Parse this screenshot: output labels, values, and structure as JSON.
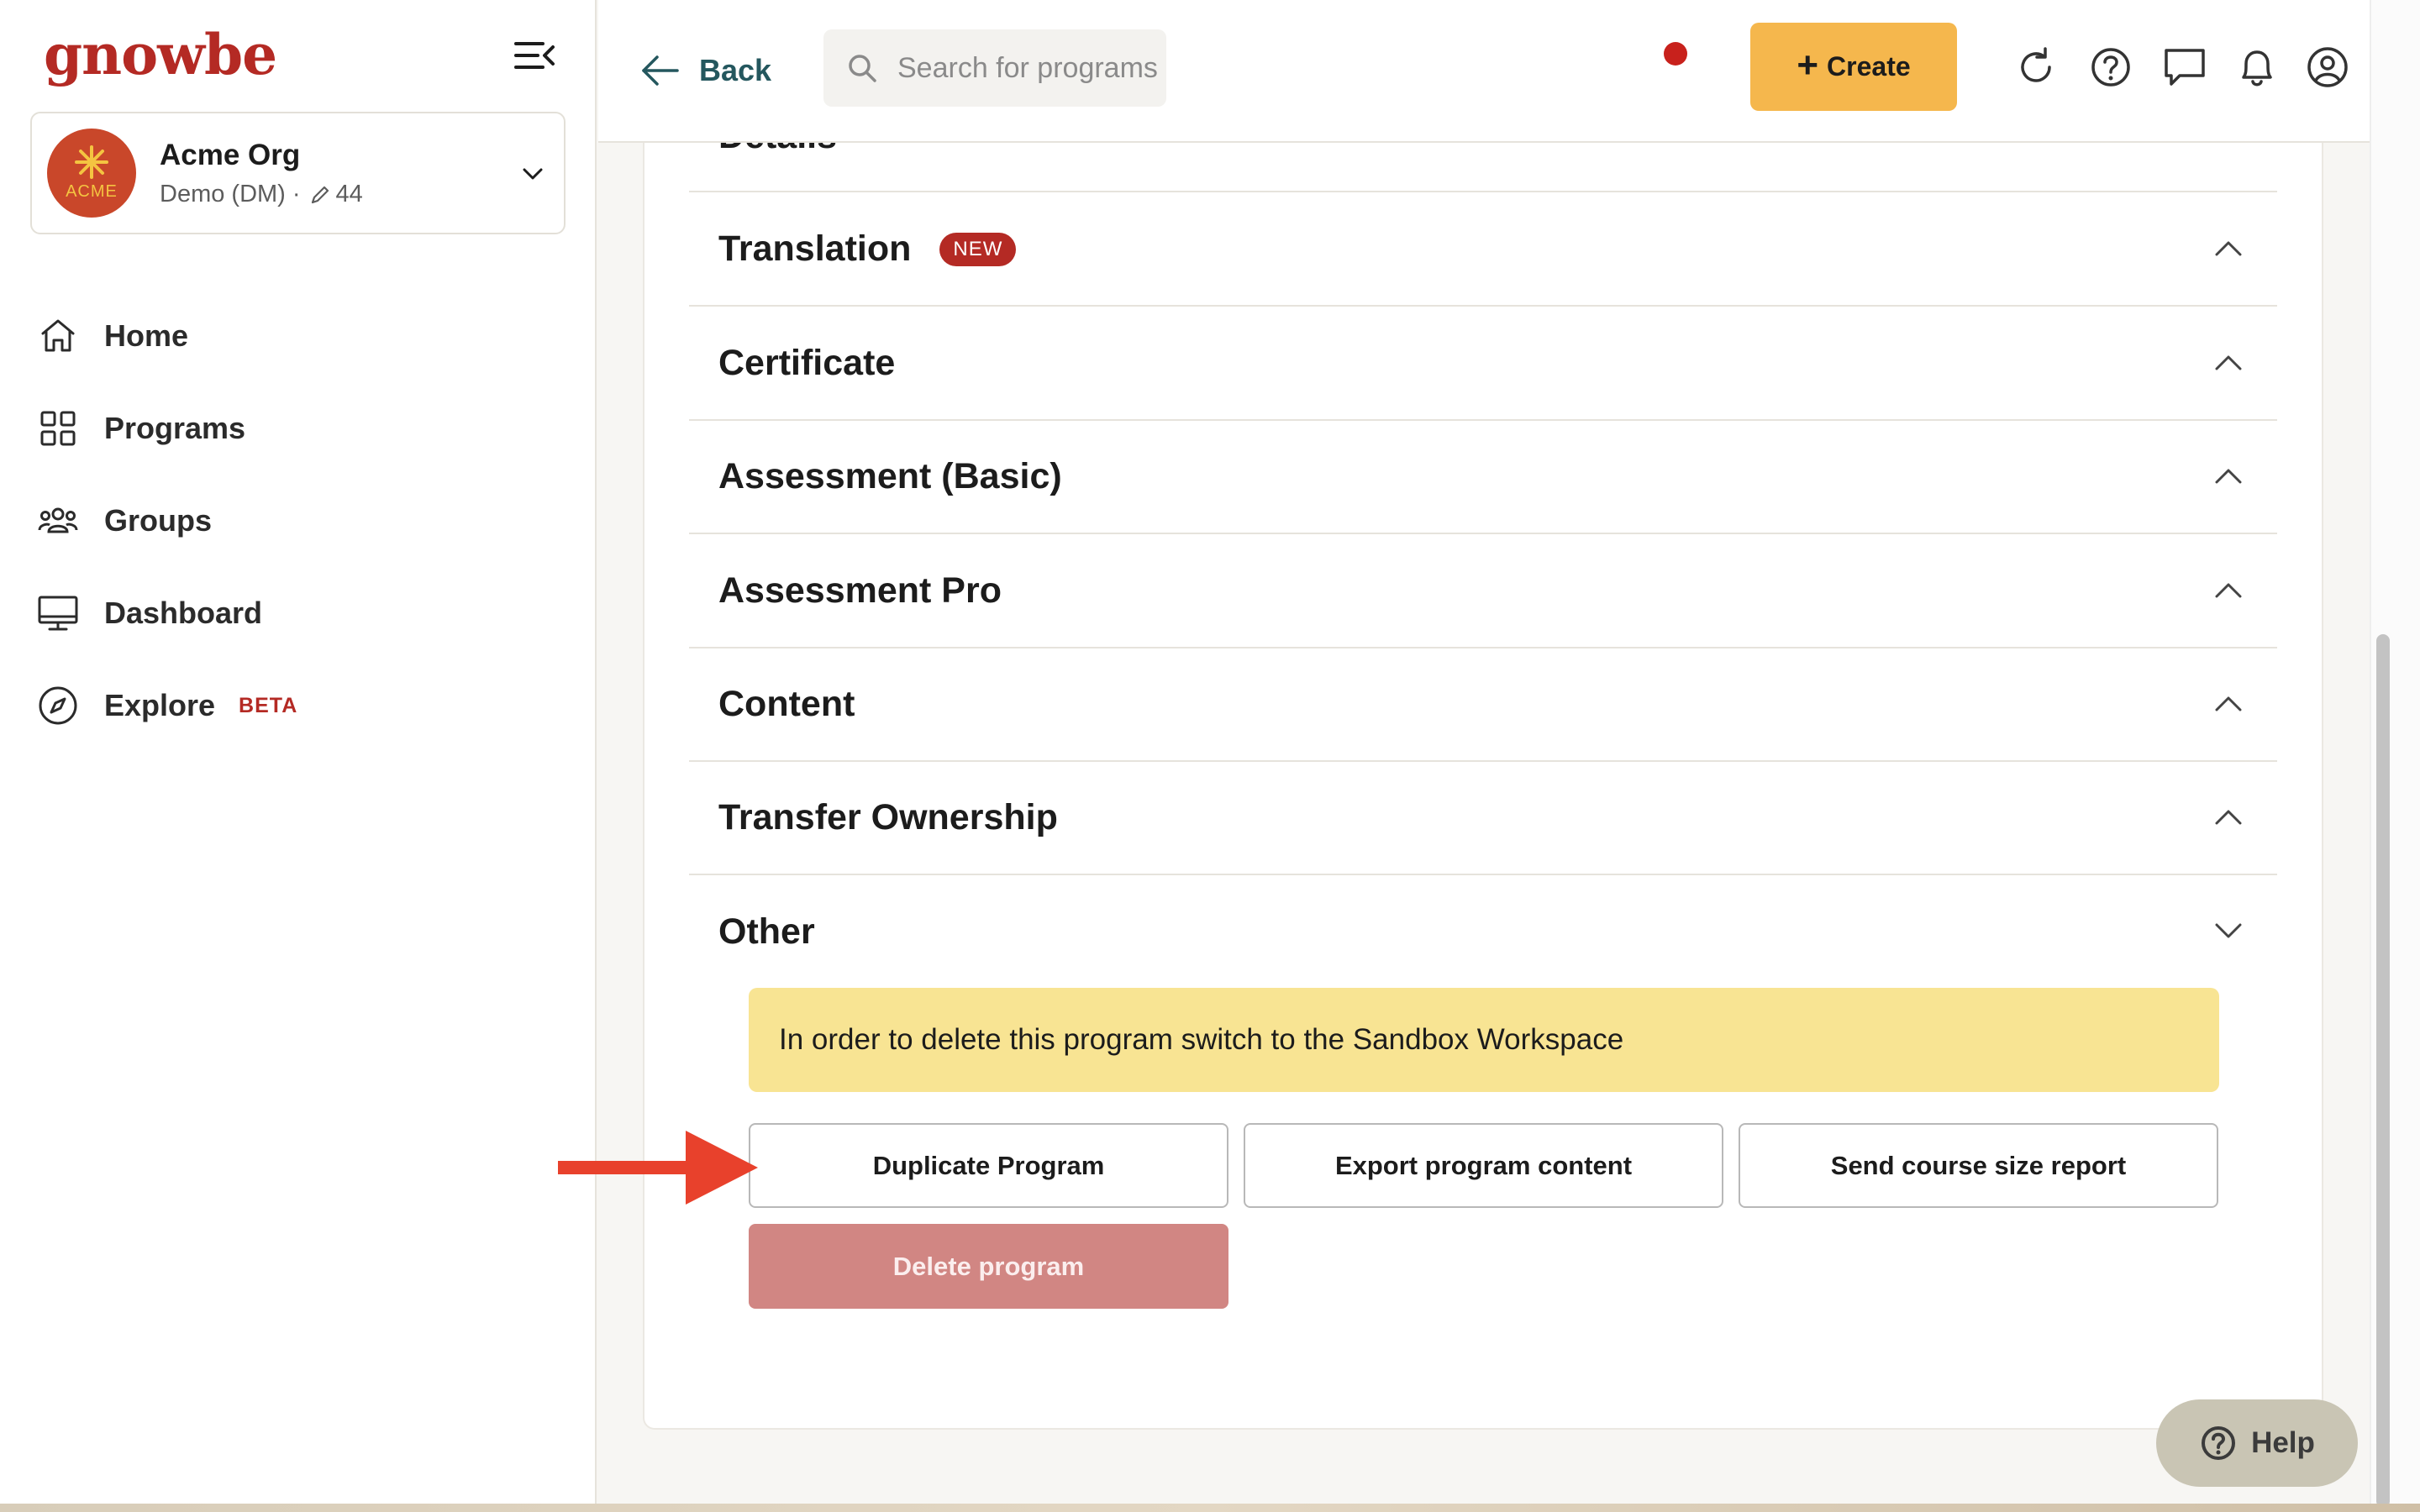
{
  "app": {
    "logo_text": "gnowbe"
  },
  "org": {
    "avatar_text": "ACME",
    "name": "Acme Org",
    "subtitle": "Demo (DM) ·",
    "edit_count": "44"
  },
  "nav": {
    "items": [
      {
        "label": "Home",
        "icon": "home-icon"
      },
      {
        "label": "Programs",
        "icon": "grid-icon"
      },
      {
        "label": "Groups",
        "icon": "users-icon"
      },
      {
        "label": "Dashboard",
        "icon": "monitor-icon"
      },
      {
        "label": "Explore",
        "icon": "compass-icon",
        "badge": "BETA"
      }
    ]
  },
  "topbar": {
    "back_label": "Back",
    "search_placeholder": "Search for programs",
    "create_label": "Create"
  },
  "sections": {
    "partial_title": "Details",
    "items": [
      {
        "title": "Translation",
        "badge": "NEW",
        "state": "collapsed"
      },
      {
        "title": "Certificate",
        "state": "collapsed"
      },
      {
        "title": "Assessment (Basic)",
        "state": "collapsed"
      },
      {
        "title": "Assessment Pro",
        "state": "collapsed"
      },
      {
        "title": "Content",
        "state": "collapsed"
      },
      {
        "title": "Transfer Ownership",
        "state": "collapsed"
      },
      {
        "title": "Other",
        "state": "expanded"
      }
    ]
  },
  "other": {
    "notice": "In order to delete this program switch to the Sandbox Workspace",
    "actions": {
      "duplicate": "Duplicate Program",
      "export": "Export program content",
      "report": "Send course size report",
      "delete": "Delete program"
    }
  },
  "help": {
    "label": "Help"
  },
  "colors": {
    "brand": "#b42a24",
    "accent_button": "#f5b74d",
    "notice_bg": "#f8e493",
    "delete_disabled": "#d18683",
    "annotation_arrow": "#e8412c",
    "notification_dot": "#c8211c"
  }
}
